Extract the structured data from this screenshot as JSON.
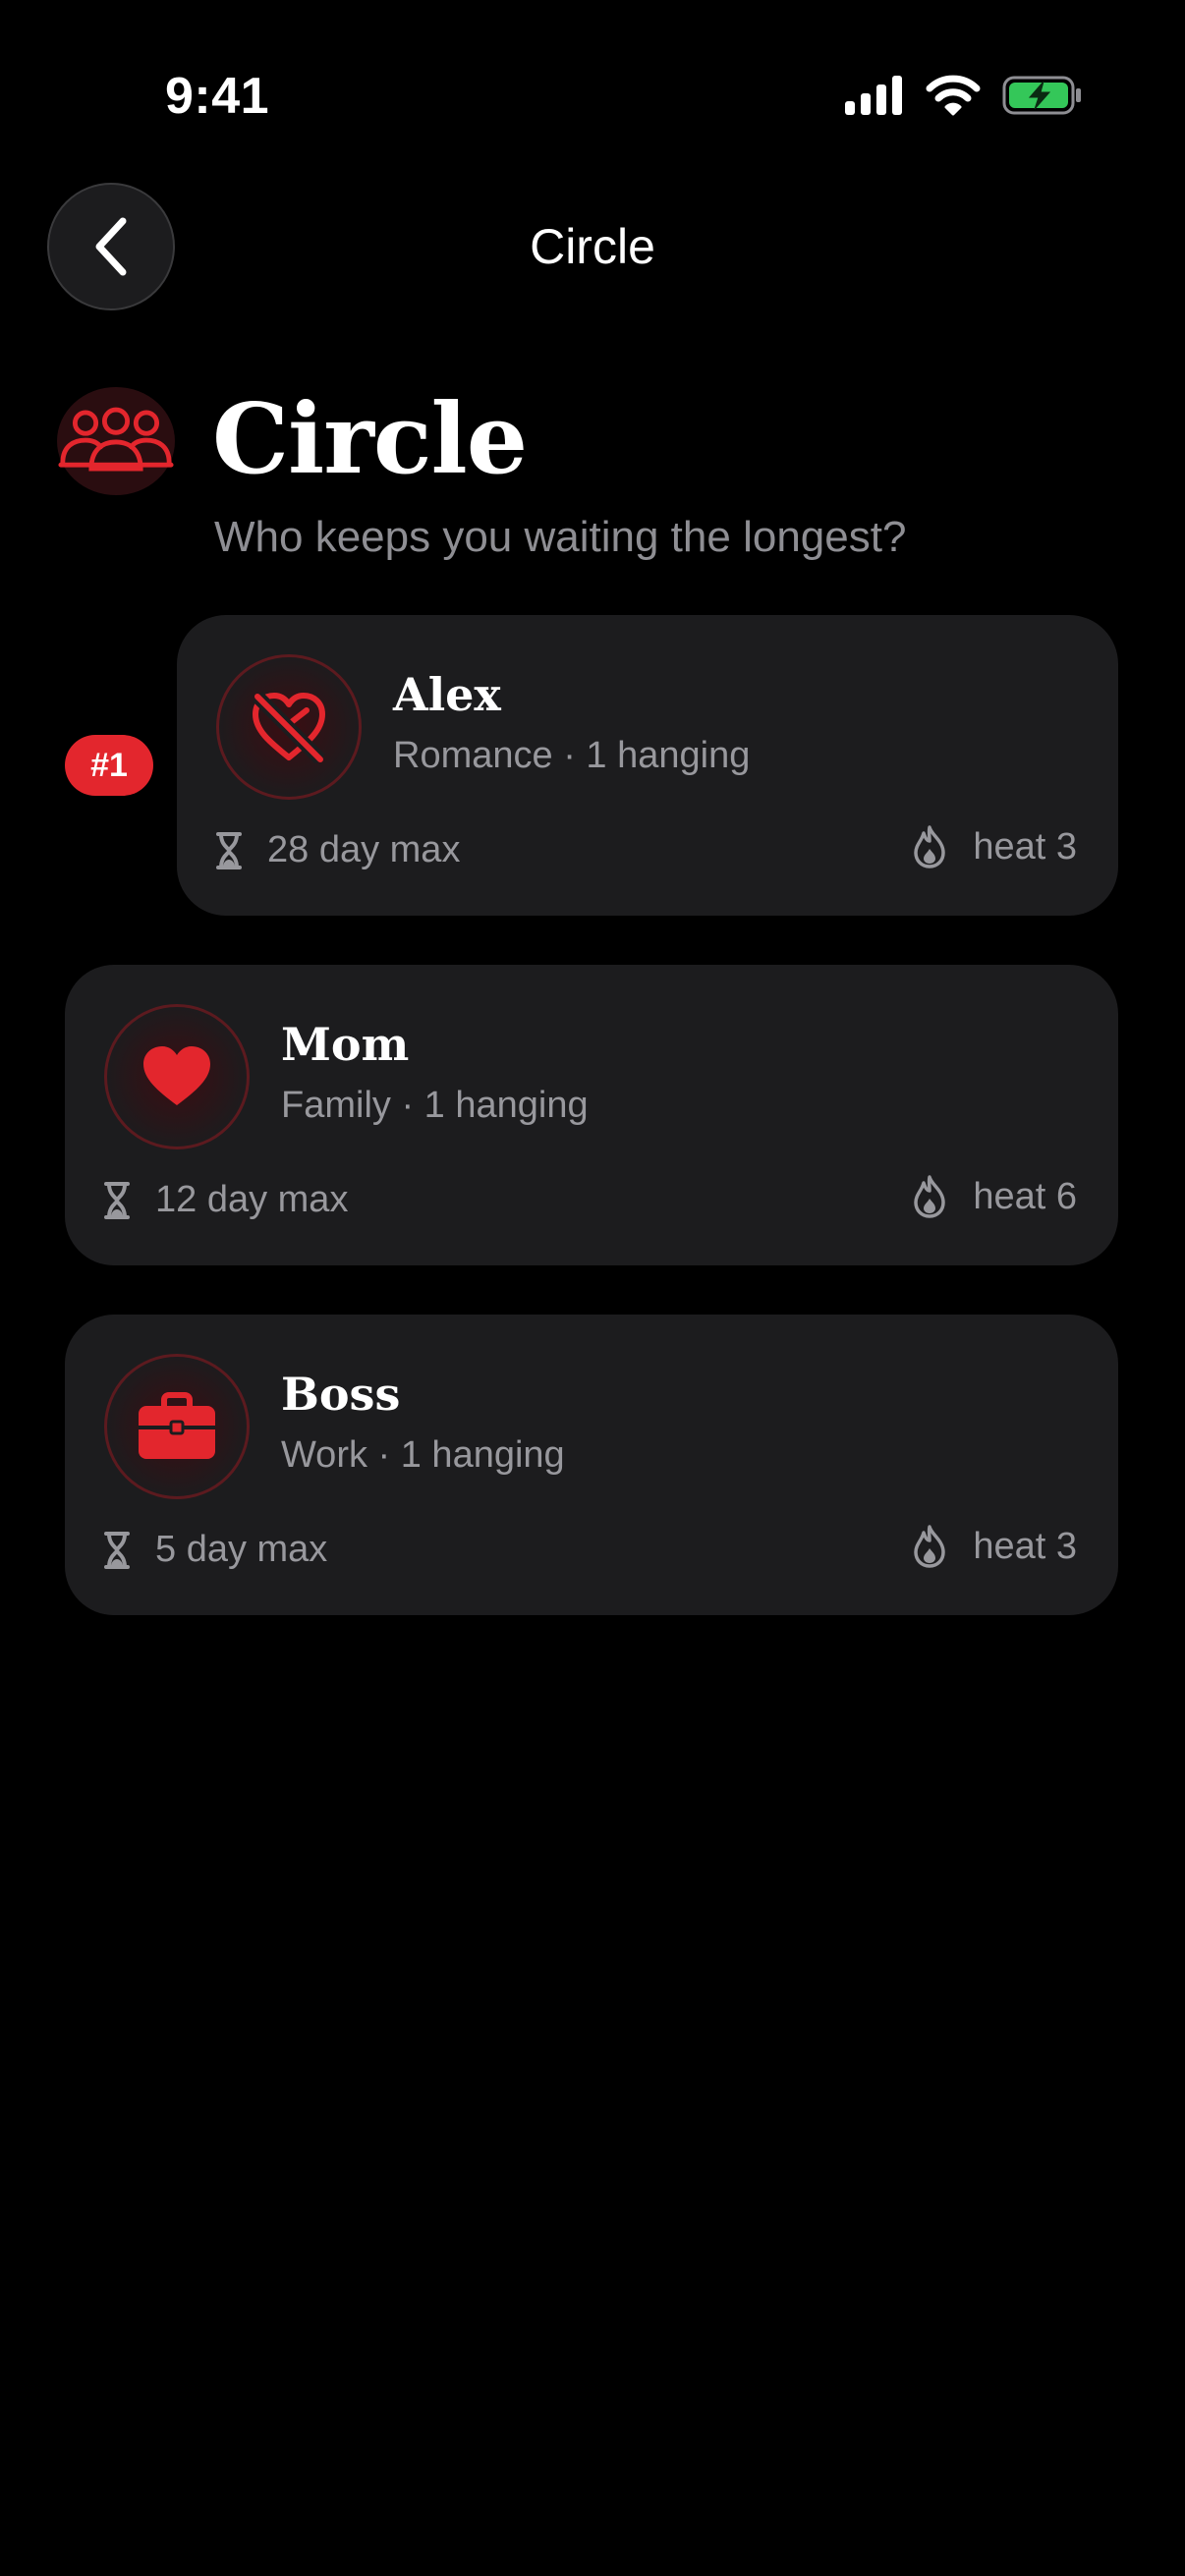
{
  "status_bar": {
    "time": "9:41",
    "icons": [
      "signal-icon",
      "wifi-icon",
      "battery-charging-icon"
    ],
    "battery_color": "#34c759"
  },
  "nav": {
    "title": "Circle",
    "back_icon": "chevron-left-icon"
  },
  "header": {
    "icon": "people-group-icon",
    "title": "Circle",
    "subtitle": "Who keeps you waiting the longest?"
  },
  "accent_color": "#e3262d",
  "contacts": [
    {
      "rank": "#1",
      "name": "Alex",
      "meta": "Romance · 1 hanging",
      "icon": "heart-slash-icon",
      "max": "28 day max",
      "heat": "heat 3"
    },
    {
      "name": "Mom",
      "meta": "Family · 1 hanging",
      "icon": "heart-icon",
      "max": "12 day max",
      "heat": "heat 6"
    },
    {
      "name": "Boss",
      "meta": "Work · 1 hanging",
      "icon": "briefcase-icon",
      "max": "5 day max",
      "heat": "heat 3"
    }
  ]
}
